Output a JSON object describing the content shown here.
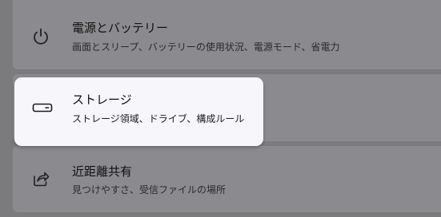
{
  "settings_list": {
    "items": [
      {
        "icon": "power-icon",
        "title": "電源とバッテリー",
        "description": "画面とスリープ、バッテリーの使用状況、電源モード、省電力"
      },
      {
        "icon": "storage-drive-icon",
        "title": "ストレージ",
        "description": "ストレージ領域、ドライブ、構成ルール"
      },
      {
        "icon": "share-icon",
        "title": "近距離共有",
        "description": "見つけやすさ、受信ファイルの場所"
      }
    ]
  },
  "colors": {
    "dim_overlay_background": "#7b7b7e",
    "row_background": "#8b8b8f",
    "highlight_card_background": "#f7f7fb"
  }
}
